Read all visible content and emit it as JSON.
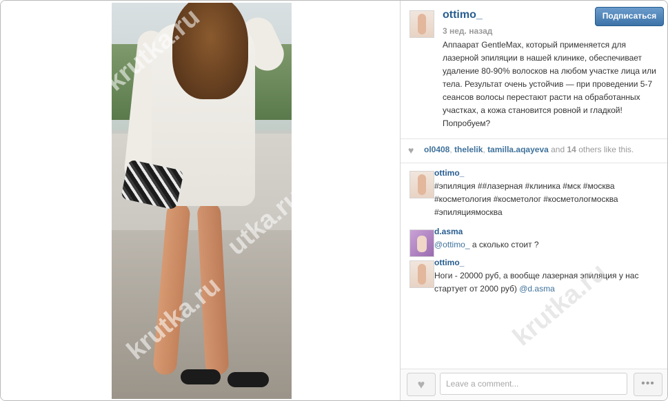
{
  "post": {
    "username": "ottimo_",
    "time": "3 нед. назад",
    "follow_label": "Подписаться",
    "caption": "Аппаарат GentleMax, который применяется для лазерной эпиляции в нашей клинике, обеспечивает удаление 80-90% волосков на любом участке лица или тела. Результат очень устойчив — при проведении 5-7 сеансов волосы перестают расти на обработанных участках, а кожа становится ровной и гладкой! Попробуем?"
  },
  "watermark": [
    "krutka.ru",
    "utka.ru",
    "krutka.ru",
    "krutka.ru"
  ],
  "likes": {
    "users": [
      "ol0408",
      "thelelik",
      "tamilla.aqayeva"
    ],
    "sep1": ", ",
    "sep2": ", ",
    "and": " and ",
    "count": "14",
    "suffix": " others like this."
  },
  "comments": [
    {
      "username": "ottimo_",
      "text": "#эпиляция ##лазерная #клиника #мск #москва #косметология #косметолог #косметологмосква #эпиляциямосква"
    },
    {
      "username": "d.asma",
      "mention": "@ottimo_",
      "text": " а сколько стоит ?"
    },
    {
      "username": "ottimo_",
      "text": "Ноги - 20000 руб, а вообще лазерная эпиляция у нас стартует от 2000 руб) ",
      "mention": "@d.asma"
    }
  ],
  "input": {
    "placeholder": "Leave a comment..."
  },
  "icons": {
    "heart": "heart-icon",
    "more": "more-dots-icon"
  },
  "colors": {
    "link": "#3f729b",
    "follow_bg": "#3d73a8"
  }
}
